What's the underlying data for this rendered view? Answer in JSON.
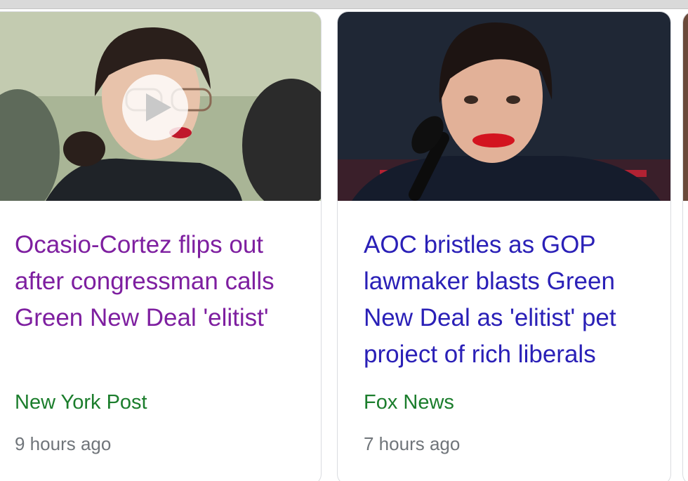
{
  "cards": [
    {
      "headline": "Ocasio-Cortez flips out after congressman calls Green New Deal 'elitist'",
      "source": "New York Post",
      "time": "9 hours ago",
      "has_video": true
    },
    {
      "headline": "AOC bristles as GOP lawmaker blasts Green New Deal as 'elitist' pet project of rich liberals",
      "source": "Fox News",
      "time": "7 hours ago",
      "has_video": false
    }
  ],
  "colors": {
    "visited_link": "#7e1fa0",
    "link": "#2a20b7",
    "source": "#1b7d2c",
    "timestamp": "#70757a"
  },
  "icons": {
    "play": "play-icon"
  }
}
